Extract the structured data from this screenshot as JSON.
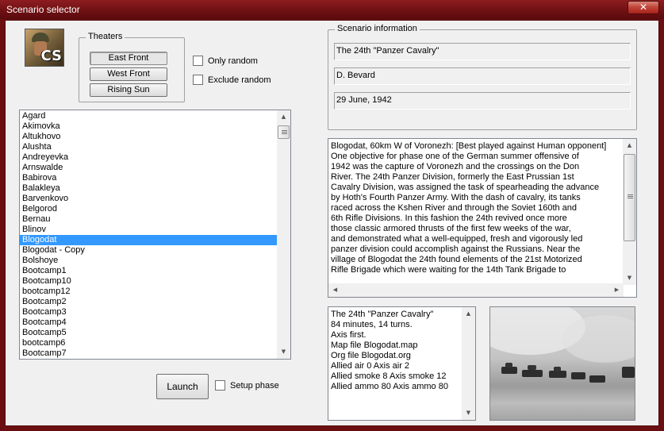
{
  "window": {
    "title": "Scenario selector",
    "close_glyph": "✕"
  },
  "logo": {
    "text": "CS"
  },
  "theaters": {
    "legend": "Theaters",
    "buttons": [
      "East Front",
      "West Front",
      "Rising Sun"
    ],
    "selected": "East Front"
  },
  "filters": {
    "only_random": "Only random",
    "exclude_random": "Exclude random"
  },
  "scenario_list": {
    "items": [
      "Agard",
      "Akimovka",
      "Altukhovo",
      "Alushta",
      "Andreyevka",
      "Arnswalde",
      "Babirova",
      "Balakleya",
      "Barvenkovo",
      "Belgorod",
      "Bernau",
      "Blinov",
      "Blogodat",
      "Blogodat - Copy",
      "Bolshoye",
      "Bootcamp1",
      "Bootcamp10",
      "bootcamp12",
      "Bootcamp2",
      "Bootcamp3",
      "Bootcamp4",
      "Bootcamp5",
      "bootcamp6",
      "Bootcamp7"
    ],
    "selected": "Blogodat"
  },
  "actions": {
    "launch": "Launch",
    "setup_phase": "Setup phase"
  },
  "scenario_info": {
    "legend": "Scenario information",
    "name": "The 24th \"Panzer Cavalry\"",
    "author": "D. Bevard",
    "date": "29 June, 1942"
  },
  "description": [
    "Blogodat, 60km W of Voronezh: [Best played against Human opponent]",
    "One objective for phase one of the German summer offensive of",
    "1942 was the capture of Voronezh and the crossings on the Don",
    "River. The 24th Panzer Division, formerly the East Prussian 1st",
    "Cavalry Division, was assigned the task of spearheading the advance",
    "by Hoth's Fourth Panzer Army. With the dash of cavalry, its tanks",
    "raced across the Kshen River and through the Soviet 160th and",
    "6th Rifle Divisions. In this fashion the 24th revived once more",
    "those classic armored thrusts of the first few weeks of the war,",
    "and demonstrated what a well-equipped, fresh and vigorously led",
    "panzer division could accomplish against the Russians. Near the",
    "village of Blogodat the 24th found elements of the 21st Motorized",
    "Rifle Brigade which were waiting for the 14th Tank Brigade to"
  ],
  "details": [
    "The 24th \"Panzer Cavalry\"",
    "84 minutes, 14 turns.",
    "Axis first.",
    "Map file Blogodat.map",
    "Org file Blogodat.org",
    "Allied air 0 Axis air 2",
    "Allied smoke 8 Axis smoke 12",
    "Allied ammo 80 Axis ammo 80"
  ],
  "colors": {
    "titlebar": "#6d1013",
    "selection": "#3399ff",
    "client": "#f0f0f0"
  },
  "icons": {
    "close": "close-icon",
    "scroll_up": "scroll-up-arrow-icon",
    "scroll_down": "scroll-down-arrow-icon",
    "scroll_left": "scroll-left-arrow-icon",
    "scroll_right": "scroll-right-arrow-icon"
  }
}
